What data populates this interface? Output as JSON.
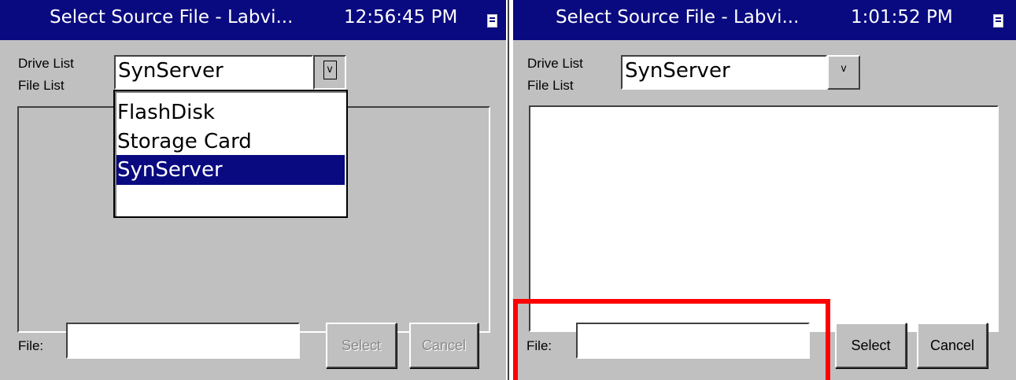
{
  "left_panel": {
    "title": "Select Source File - Labvi...",
    "time": "12:56:45 PM",
    "drive_list_label": "Drive List",
    "file_list_label": "File List",
    "drive_value": "SynServer",
    "dropdown_button": "v",
    "dropdown_open": true,
    "dropdown_items": [
      {
        "label": "FlashDisk",
        "selected": false
      },
      {
        "label": "Storage Card",
        "selected": false
      },
      {
        "label": "SynServer",
        "selected": true
      }
    ],
    "file_label": "File:",
    "file_value": "",
    "select_label": "Select",
    "cancel_label": "Cancel",
    "buttons_enabled": false
  },
  "right_panel": {
    "title": "Select Source File - Labvi...",
    "time": "1:01:52 PM",
    "drive_list_label": "Drive List",
    "file_list_label": "File List",
    "drive_value": "SynServer",
    "dropdown_button": "v",
    "file_label": "File:",
    "file_value": "",
    "select_label": "Select",
    "cancel_label": "Cancel",
    "buttons_enabled": true
  },
  "colors": {
    "titlebar": "#0a0a80",
    "window_bg": "#c0c0c0",
    "selection": "#0a0a80",
    "annotation": "#ff0000"
  }
}
